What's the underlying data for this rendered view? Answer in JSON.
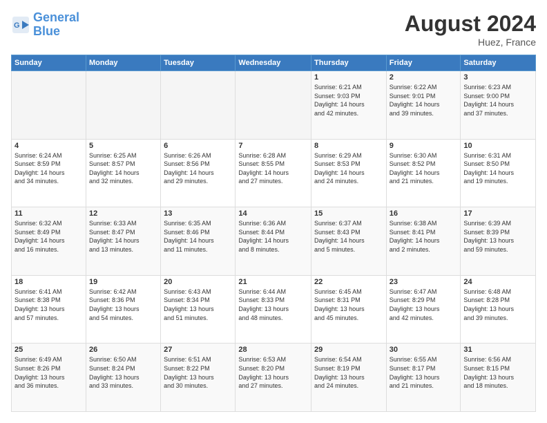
{
  "header": {
    "logo_line1": "General",
    "logo_line2": "Blue",
    "title": "August 2024",
    "location": "Huez, France"
  },
  "weekdays": [
    "Sunday",
    "Monday",
    "Tuesday",
    "Wednesday",
    "Thursday",
    "Friday",
    "Saturday"
  ],
  "weeks": [
    [
      {
        "day": "",
        "info": ""
      },
      {
        "day": "",
        "info": ""
      },
      {
        "day": "",
        "info": ""
      },
      {
        "day": "",
        "info": ""
      },
      {
        "day": "1",
        "info": "Sunrise: 6:21 AM\nSunset: 9:03 PM\nDaylight: 14 hours\nand 42 minutes."
      },
      {
        "day": "2",
        "info": "Sunrise: 6:22 AM\nSunset: 9:01 PM\nDaylight: 14 hours\nand 39 minutes."
      },
      {
        "day": "3",
        "info": "Sunrise: 6:23 AM\nSunset: 9:00 PM\nDaylight: 14 hours\nand 37 minutes."
      }
    ],
    [
      {
        "day": "4",
        "info": "Sunrise: 6:24 AM\nSunset: 8:59 PM\nDaylight: 14 hours\nand 34 minutes."
      },
      {
        "day": "5",
        "info": "Sunrise: 6:25 AM\nSunset: 8:57 PM\nDaylight: 14 hours\nand 32 minutes."
      },
      {
        "day": "6",
        "info": "Sunrise: 6:26 AM\nSunset: 8:56 PM\nDaylight: 14 hours\nand 29 minutes."
      },
      {
        "day": "7",
        "info": "Sunrise: 6:28 AM\nSunset: 8:55 PM\nDaylight: 14 hours\nand 27 minutes."
      },
      {
        "day": "8",
        "info": "Sunrise: 6:29 AM\nSunset: 8:53 PM\nDaylight: 14 hours\nand 24 minutes."
      },
      {
        "day": "9",
        "info": "Sunrise: 6:30 AM\nSunset: 8:52 PM\nDaylight: 14 hours\nand 21 minutes."
      },
      {
        "day": "10",
        "info": "Sunrise: 6:31 AM\nSunset: 8:50 PM\nDaylight: 14 hours\nand 19 minutes."
      }
    ],
    [
      {
        "day": "11",
        "info": "Sunrise: 6:32 AM\nSunset: 8:49 PM\nDaylight: 14 hours\nand 16 minutes."
      },
      {
        "day": "12",
        "info": "Sunrise: 6:33 AM\nSunset: 8:47 PM\nDaylight: 14 hours\nand 13 minutes."
      },
      {
        "day": "13",
        "info": "Sunrise: 6:35 AM\nSunset: 8:46 PM\nDaylight: 14 hours\nand 11 minutes."
      },
      {
        "day": "14",
        "info": "Sunrise: 6:36 AM\nSunset: 8:44 PM\nDaylight: 14 hours\nand 8 minutes."
      },
      {
        "day": "15",
        "info": "Sunrise: 6:37 AM\nSunset: 8:43 PM\nDaylight: 14 hours\nand 5 minutes."
      },
      {
        "day": "16",
        "info": "Sunrise: 6:38 AM\nSunset: 8:41 PM\nDaylight: 14 hours\nand 2 minutes."
      },
      {
        "day": "17",
        "info": "Sunrise: 6:39 AM\nSunset: 8:39 PM\nDaylight: 13 hours\nand 59 minutes."
      }
    ],
    [
      {
        "day": "18",
        "info": "Sunrise: 6:41 AM\nSunset: 8:38 PM\nDaylight: 13 hours\nand 57 minutes."
      },
      {
        "day": "19",
        "info": "Sunrise: 6:42 AM\nSunset: 8:36 PM\nDaylight: 13 hours\nand 54 minutes."
      },
      {
        "day": "20",
        "info": "Sunrise: 6:43 AM\nSunset: 8:34 PM\nDaylight: 13 hours\nand 51 minutes."
      },
      {
        "day": "21",
        "info": "Sunrise: 6:44 AM\nSunset: 8:33 PM\nDaylight: 13 hours\nand 48 minutes."
      },
      {
        "day": "22",
        "info": "Sunrise: 6:45 AM\nSunset: 8:31 PM\nDaylight: 13 hours\nand 45 minutes."
      },
      {
        "day": "23",
        "info": "Sunrise: 6:47 AM\nSunset: 8:29 PM\nDaylight: 13 hours\nand 42 minutes."
      },
      {
        "day": "24",
        "info": "Sunrise: 6:48 AM\nSunset: 8:28 PM\nDaylight: 13 hours\nand 39 minutes."
      }
    ],
    [
      {
        "day": "25",
        "info": "Sunrise: 6:49 AM\nSunset: 8:26 PM\nDaylight: 13 hours\nand 36 minutes."
      },
      {
        "day": "26",
        "info": "Sunrise: 6:50 AM\nSunset: 8:24 PM\nDaylight: 13 hours\nand 33 minutes."
      },
      {
        "day": "27",
        "info": "Sunrise: 6:51 AM\nSunset: 8:22 PM\nDaylight: 13 hours\nand 30 minutes."
      },
      {
        "day": "28",
        "info": "Sunrise: 6:53 AM\nSunset: 8:20 PM\nDaylight: 13 hours\nand 27 minutes."
      },
      {
        "day": "29",
        "info": "Sunrise: 6:54 AM\nSunset: 8:19 PM\nDaylight: 13 hours\nand 24 minutes."
      },
      {
        "day": "30",
        "info": "Sunrise: 6:55 AM\nSunset: 8:17 PM\nDaylight: 13 hours\nand 21 minutes."
      },
      {
        "day": "31",
        "info": "Sunrise: 6:56 AM\nSunset: 8:15 PM\nDaylight: 13 hours\nand 18 minutes."
      }
    ]
  ]
}
